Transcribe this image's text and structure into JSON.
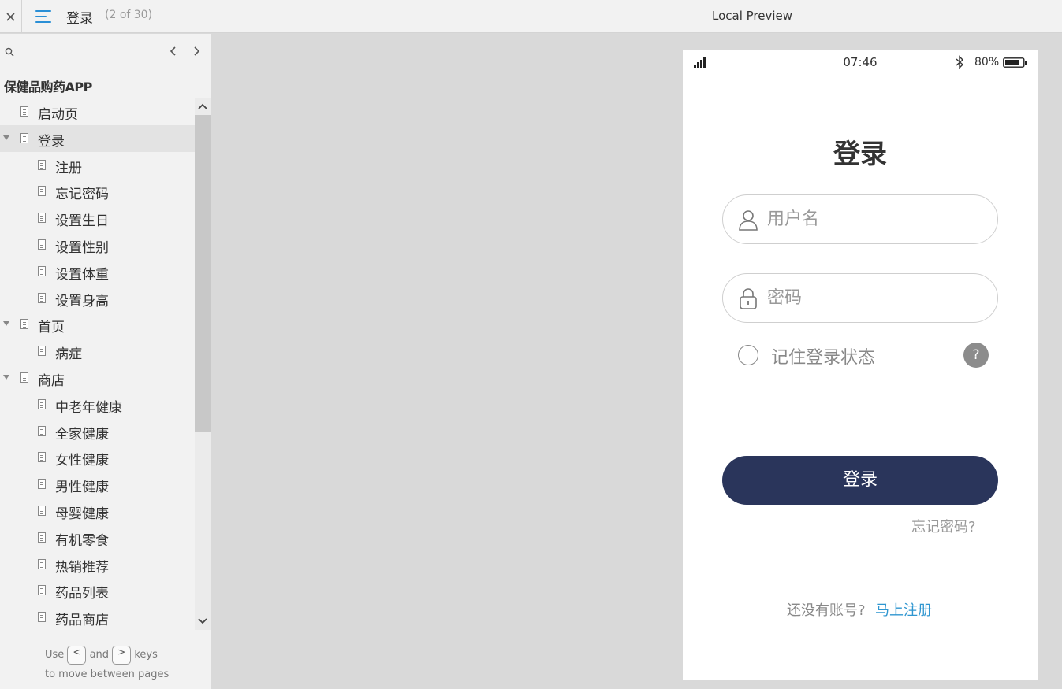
{
  "topbar": {
    "page_name": "登录",
    "page_count": "(2 of 30)",
    "preview_title": "Local Preview"
  },
  "sidebar": {
    "project_title": "保健品购药APP",
    "items": [
      {
        "label": "启动页",
        "level": 0,
        "expandable": false,
        "selected": false
      },
      {
        "label": "登录",
        "level": 0,
        "expandable": true,
        "selected": true
      },
      {
        "label": "注册",
        "level": 1,
        "expandable": false,
        "selected": false
      },
      {
        "label": "忘记密码",
        "level": 1,
        "expandable": false,
        "selected": false
      },
      {
        "label": "设置生日",
        "level": 1,
        "expandable": false,
        "selected": false
      },
      {
        "label": "设置性别",
        "level": 1,
        "expandable": false,
        "selected": false
      },
      {
        "label": "设置体重",
        "level": 1,
        "expandable": false,
        "selected": false
      },
      {
        "label": "设置身高",
        "level": 1,
        "expandable": false,
        "selected": false
      },
      {
        "label": "首页",
        "level": 0,
        "expandable": true,
        "selected": false
      },
      {
        "label": "病症",
        "level": 1,
        "expandable": false,
        "selected": false
      },
      {
        "label": "商店",
        "level": 0,
        "expandable": true,
        "selected": false
      },
      {
        "label": "中老年健康",
        "level": 1,
        "expandable": false,
        "selected": false
      },
      {
        "label": "全家健康",
        "level": 1,
        "expandable": false,
        "selected": false
      },
      {
        "label": "女性健康",
        "level": 1,
        "expandable": false,
        "selected": false
      },
      {
        "label": "男性健康",
        "level": 1,
        "expandable": false,
        "selected": false
      },
      {
        "label": "母婴健康",
        "level": 1,
        "expandable": false,
        "selected": false
      },
      {
        "label": "有机零食",
        "level": 1,
        "expandable": false,
        "selected": false
      },
      {
        "label": "热销推荐",
        "level": 1,
        "expandable": false,
        "selected": false
      },
      {
        "label": "药品列表",
        "level": 1,
        "expandable": false,
        "selected": false
      },
      {
        "label": "药品商店",
        "level": 1,
        "expandable": false,
        "selected": false
      }
    ],
    "hint": {
      "use": "Use",
      "and": "and",
      "keys": "keys",
      "line2": "to move between pages",
      "prev_key": "<",
      "next_key": ">"
    }
  },
  "phone": {
    "status": {
      "time": "07:46",
      "battery": "80%"
    },
    "title": "登录",
    "username_placeholder": "用户名",
    "password_placeholder": "密码",
    "remember_label": "记住登录状态",
    "help_label": "?",
    "login_button": "登录",
    "forgot_link": "忘记密码?",
    "no_account": "还没有账号?",
    "register_link": "马上注册"
  },
  "colors": {
    "accent_blue": "#2a8fd6",
    "login_button": "#2a355b",
    "register_link": "#2f96d0",
    "canvas": "#d9d9d9"
  }
}
